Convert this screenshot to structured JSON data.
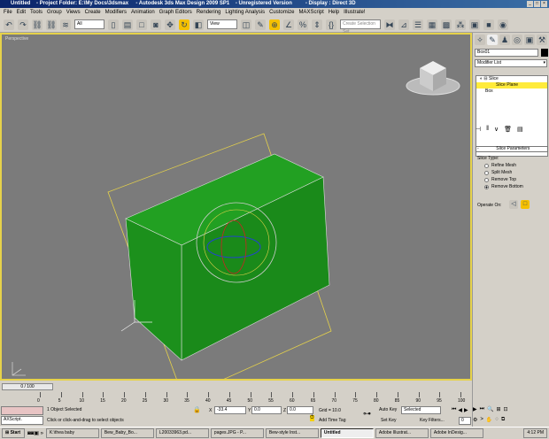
{
  "title": "Untitled    - Project Folder: E:\\My Docs\\3dsmax     - Autodesk 3ds Max Design 2009 SP1    - Unregistered Version         - Display : Direct 3D",
  "window_buttons": [
    "_",
    "□",
    "×"
  ],
  "menu": [
    "File",
    "Edit",
    "Tools",
    "Group",
    "Views",
    "Create",
    "Modifiers",
    "Animation",
    "Graph Editors",
    "Rendering",
    "Lighting Analysis",
    "Customize",
    "MAXScript",
    "Help",
    "Illustrate!"
  ],
  "toolbar": {
    "filter": "All",
    "refcoord": "View",
    "selection_set": "Create Selection Set"
  },
  "viewport": {
    "label": "Perspective",
    "object_color": "#1f8a1f",
    "bg": "#7b7b7b"
  },
  "command_panel": {
    "object_name": "Box01",
    "modifier_list": "Modifier List",
    "stack": [
      {
        "label": "Slice",
        "level": 0
      },
      {
        "label": "Slice Plane",
        "level": 1,
        "selected": true
      },
      {
        "label": "Box",
        "level": 0
      }
    ],
    "rollout_title": "Slice Parameters",
    "slice_type_label": "Slice Type:",
    "slice_types": [
      {
        "label": "Refine Mesh",
        "checked": false
      },
      {
        "label": "Split Mesh",
        "checked": false
      },
      {
        "label": "Remove Top",
        "checked": false
      },
      {
        "label": "Remove Bottom",
        "checked": true
      }
    ],
    "operate_on": "Operate On:"
  },
  "timeline": {
    "position": "0 / 100",
    "ticks": [
      "0",
      "5",
      "10",
      "15",
      "20",
      "25",
      "30",
      "35",
      "40",
      "45",
      "50",
      "55",
      "60",
      "65",
      "70",
      "75",
      "80",
      "85",
      "90",
      "95",
      "100"
    ]
  },
  "status": {
    "maxscript": "AXScript.",
    "selected": "1 Object Selected",
    "prompt": "Click or click-and-drag to select objects",
    "x": "-33.4",
    "y": "0.0",
    "z": "0.0",
    "grid": "Grid = 10.0",
    "add_time_tag": "Add Time Tag",
    "auto_key": "Auto Key",
    "set_key": "Set Key",
    "key_mode": "Selected",
    "key_filters": "Key Filters...",
    "frame": "0"
  },
  "taskbar": {
    "start": "Start",
    "tasks": [
      "K:\\thea baby",
      "Bew_Baby_Bo...",
      "L20033963.pd...",
      "pages.JPG - P...",
      "Bew-style Inst...",
      "Untitled",
      "Adobe Illustrat...",
      "Adobe InDesig..."
    ],
    "active": 5,
    "clock": "4:12 PM"
  }
}
